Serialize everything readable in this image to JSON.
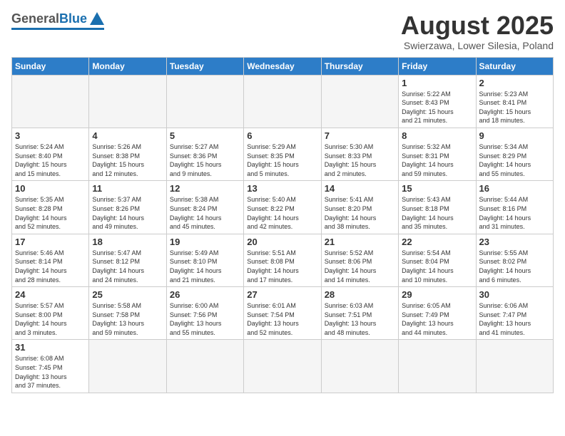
{
  "header": {
    "logo": {
      "general": "General",
      "blue": "Blue"
    },
    "title": "August 2025",
    "subtitle": "Swierzawa, Lower Silesia, Poland"
  },
  "weekdays": [
    "Sunday",
    "Monday",
    "Tuesday",
    "Wednesday",
    "Thursday",
    "Friday",
    "Saturday"
  ],
  "weeks": [
    [
      {
        "day": "",
        "info": ""
      },
      {
        "day": "",
        "info": ""
      },
      {
        "day": "",
        "info": ""
      },
      {
        "day": "",
        "info": ""
      },
      {
        "day": "",
        "info": ""
      },
      {
        "day": "1",
        "info": "Sunrise: 5:22 AM\nSunset: 8:43 PM\nDaylight: 15 hours\nand 21 minutes."
      },
      {
        "day": "2",
        "info": "Sunrise: 5:23 AM\nSunset: 8:41 PM\nDaylight: 15 hours\nand 18 minutes."
      }
    ],
    [
      {
        "day": "3",
        "info": "Sunrise: 5:24 AM\nSunset: 8:40 PM\nDaylight: 15 hours\nand 15 minutes."
      },
      {
        "day": "4",
        "info": "Sunrise: 5:26 AM\nSunset: 8:38 PM\nDaylight: 15 hours\nand 12 minutes."
      },
      {
        "day": "5",
        "info": "Sunrise: 5:27 AM\nSunset: 8:36 PM\nDaylight: 15 hours\nand 9 minutes."
      },
      {
        "day": "6",
        "info": "Sunrise: 5:29 AM\nSunset: 8:35 PM\nDaylight: 15 hours\nand 5 minutes."
      },
      {
        "day": "7",
        "info": "Sunrise: 5:30 AM\nSunset: 8:33 PM\nDaylight: 15 hours\nand 2 minutes."
      },
      {
        "day": "8",
        "info": "Sunrise: 5:32 AM\nSunset: 8:31 PM\nDaylight: 14 hours\nand 59 minutes."
      },
      {
        "day": "9",
        "info": "Sunrise: 5:34 AM\nSunset: 8:29 PM\nDaylight: 14 hours\nand 55 minutes."
      }
    ],
    [
      {
        "day": "10",
        "info": "Sunrise: 5:35 AM\nSunset: 8:28 PM\nDaylight: 14 hours\nand 52 minutes."
      },
      {
        "day": "11",
        "info": "Sunrise: 5:37 AM\nSunset: 8:26 PM\nDaylight: 14 hours\nand 49 minutes."
      },
      {
        "day": "12",
        "info": "Sunrise: 5:38 AM\nSunset: 8:24 PM\nDaylight: 14 hours\nand 45 minutes."
      },
      {
        "day": "13",
        "info": "Sunrise: 5:40 AM\nSunset: 8:22 PM\nDaylight: 14 hours\nand 42 minutes."
      },
      {
        "day": "14",
        "info": "Sunrise: 5:41 AM\nSunset: 8:20 PM\nDaylight: 14 hours\nand 38 minutes."
      },
      {
        "day": "15",
        "info": "Sunrise: 5:43 AM\nSunset: 8:18 PM\nDaylight: 14 hours\nand 35 minutes."
      },
      {
        "day": "16",
        "info": "Sunrise: 5:44 AM\nSunset: 8:16 PM\nDaylight: 14 hours\nand 31 minutes."
      }
    ],
    [
      {
        "day": "17",
        "info": "Sunrise: 5:46 AM\nSunset: 8:14 PM\nDaylight: 14 hours\nand 28 minutes."
      },
      {
        "day": "18",
        "info": "Sunrise: 5:47 AM\nSunset: 8:12 PM\nDaylight: 14 hours\nand 24 minutes."
      },
      {
        "day": "19",
        "info": "Sunrise: 5:49 AM\nSunset: 8:10 PM\nDaylight: 14 hours\nand 21 minutes."
      },
      {
        "day": "20",
        "info": "Sunrise: 5:51 AM\nSunset: 8:08 PM\nDaylight: 14 hours\nand 17 minutes."
      },
      {
        "day": "21",
        "info": "Sunrise: 5:52 AM\nSunset: 8:06 PM\nDaylight: 14 hours\nand 14 minutes."
      },
      {
        "day": "22",
        "info": "Sunrise: 5:54 AM\nSunset: 8:04 PM\nDaylight: 14 hours\nand 10 minutes."
      },
      {
        "day": "23",
        "info": "Sunrise: 5:55 AM\nSunset: 8:02 PM\nDaylight: 14 hours\nand 6 minutes."
      }
    ],
    [
      {
        "day": "24",
        "info": "Sunrise: 5:57 AM\nSunset: 8:00 PM\nDaylight: 14 hours\nand 3 minutes."
      },
      {
        "day": "25",
        "info": "Sunrise: 5:58 AM\nSunset: 7:58 PM\nDaylight: 13 hours\nand 59 minutes."
      },
      {
        "day": "26",
        "info": "Sunrise: 6:00 AM\nSunset: 7:56 PM\nDaylight: 13 hours\nand 55 minutes."
      },
      {
        "day": "27",
        "info": "Sunrise: 6:01 AM\nSunset: 7:54 PM\nDaylight: 13 hours\nand 52 minutes."
      },
      {
        "day": "28",
        "info": "Sunrise: 6:03 AM\nSunset: 7:51 PM\nDaylight: 13 hours\nand 48 minutes."
      },
      {
        "day": "29",
        "info": "Sunrise: 6:05 AM\nSunset: 7:49 PM\nDaylight: 13 hours\nand 44 minutes."
      },
      {
        "day": "30",
        "info": "Sunrise: 6:06 AM\nSunset: 7:47 PM\nDaylight: 13 hours\nand 41 minutes."
      }
    ],
    [
      {
        "day": "31",
        "info": "Sunrise: 6:08 AM\nSunset: 7:45 PM\nDaylight: 13 hours\nand 37 minutes."
      },
      {
        "day": "",
        "info": ""
      },
      {
        "day": "",
        "info": ""
      },
      {
        "day": "",
        "info": ""
      },
      {
        "day": "",
        "info": ""
      },
      {
        "day": "",
        "info": ""
      },
      {
        "day": "",
        "info": ""
      }
    ]
  ]
}
